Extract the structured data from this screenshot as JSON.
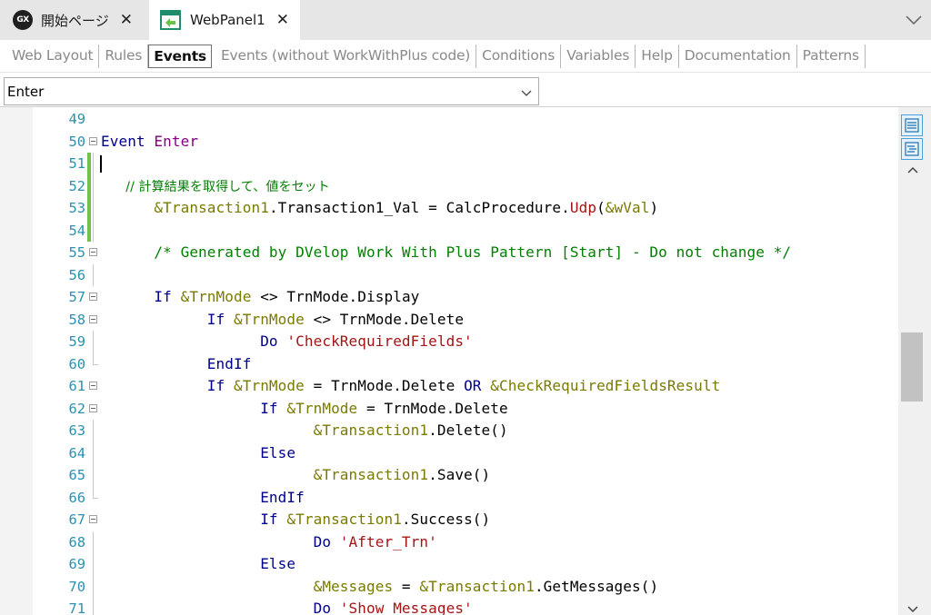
{
  "tabs": [
    {
      "label": "開始ページ",
      "icon": "genexus-logo-icon",
      "active": false
    },
    {
      "label": "WebPanel1",
      "icon": "webpanel-icon",
      "active": true
    }
  ],
  "close_glyph": "✕",
  "gx_logo_text": "GX",
  "sub_tabs": [
    "Web Layout",
    "Rules",
    "Events",
    "Events (without WorkWithPlus code)",
    "Conditions",
    "Variables",
    "Help",
    "Documentation",
    "Patterns"
  ],
  "active_sub_tab": "Events",
  "event_selector": {
    "value": "Enter"
  },
  "code_lines": [
    {
      "n": "49",
      "text": ""
    },
    {
      "n": "50",
      "text": "Event Enter"
    },
    {
      "n": "51",
      "text": ""
    },
    {
      "n": "52",
      "text": "      // 計算結果を取得して、値をセット"
    },
    {
      "n": "53",
      "text": "      &Transaction1.Transaction1_Val = CalcProcedure.Udp(&wVal)"
    },
    {
      "n": "54",
      "text": ""
    },
    {
      "n": "55",
      "text": "      /* Generated by DVelop Work With Plus Pattern [Start] - Do not change */"
    },
    {
      "n": "56",
      "text": ""
    },
    {
      "n": "57",
      "text": "      If &TrnMode <> TrnMode.Display"
    },
    {
      "n": "58",
      "text": "            If &TrnMode <> TrnMode.Delete"
    },
    {
      "n": "59",
      "text": "                  Do 'CheckRequiredFields'"
    },
    {
      "n": "60",
      "text": "            EndIf"
    },
    {
      "n": "61",
      "text": "            If &TrnMode = TrnMode.Delete OR &CheckRequiredFieldsResult"
    },
    {
      "n": "62",
      "text": "                  If &TrnMode = TrnMode.Delete"
    },
    {
      "n": "63",
      "text": "                        &Transaction1.Delete()"
    },
    {
      "n": "64",
      "text": "                  Else"
    },
    {
      "n": "65",
      "text": "                        &Transaction1.Save()"
    },
    {
      "n": "66",
      "text": "                  EndIf"
    },
    {
      "n": "67",
      "text": "                  If &Transaction1.Success()"
    },
    {
      "n": "68",
      "text": "                        Do 'After_Trn'"
    },
    {
      "n": "69",
      "text": "                  Else"
    },
    {
      "n": "70",
      "text": "                        &Messages = &Transaction1.GetMessages()"
    },
    {
      "n": "71",
      "text": "                        Do 'Show Messages'"
    }
  ],
  "colors": {
    "keyword": "#00008b",
    "event_name": "#800080",
    "variable": "#7a7a00",
    "string": "#a31515",
    "comment": "#008000",
    "line_number": "#2b91af",
    "changed_line_marker": "#6cc24a"
  }
}
